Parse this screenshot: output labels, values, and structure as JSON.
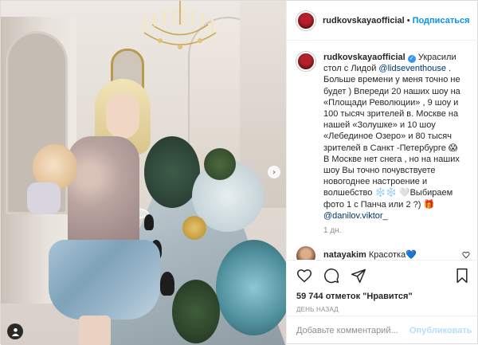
{
  "post": {
    "username": "rudkovskayaofficial",
    "follow_label": "Подписаться",
    "dot": "•",
    "verified_glyph": "✓"
  },
  "caption": {
    "username": "rudkovskayaofficial",
    "part1": " Украсили стол с Лидой ",
    "mention1": "@lidseventhouse",
    "part2": " . Больше времени у меня точно не будет ) Впереди 20 наших шоу на «Площади Революции» , 9 шоу и 100 тысяч зрителей в. Москве на нашей «Золушке» и 10 шоу «Лебединое Озеро» и 80 тысяч зрителей в Санкт -Петербурге 😱 В Москве нет снега , но на наших шоу Вы точно почувствуете новогоднее настроение и волшебство ❄️❄️ 🤍Выбираем фото 1 с Панча или 2 ?) ",
    "emoji_mention": "🎁",
    "mention2": "@danilov.viktor_",
    "time": "1 дн."
  },
  "comment": {
    "username": "natayakim",
    "text": "Красотка",
    "emoji": "💙"
  },
  "actions": {
    "likes": "59 744 отметок \"Нравится\"",
    "ago": "ДЕНЬ НАЗАД"
  },
  "add_comment": {
    "placeholder": "Добавьте комментарий...",
    "publish_label": "Опубликовать"
  },
  "photo": {
    "next_arrow": "›"
  }
}
